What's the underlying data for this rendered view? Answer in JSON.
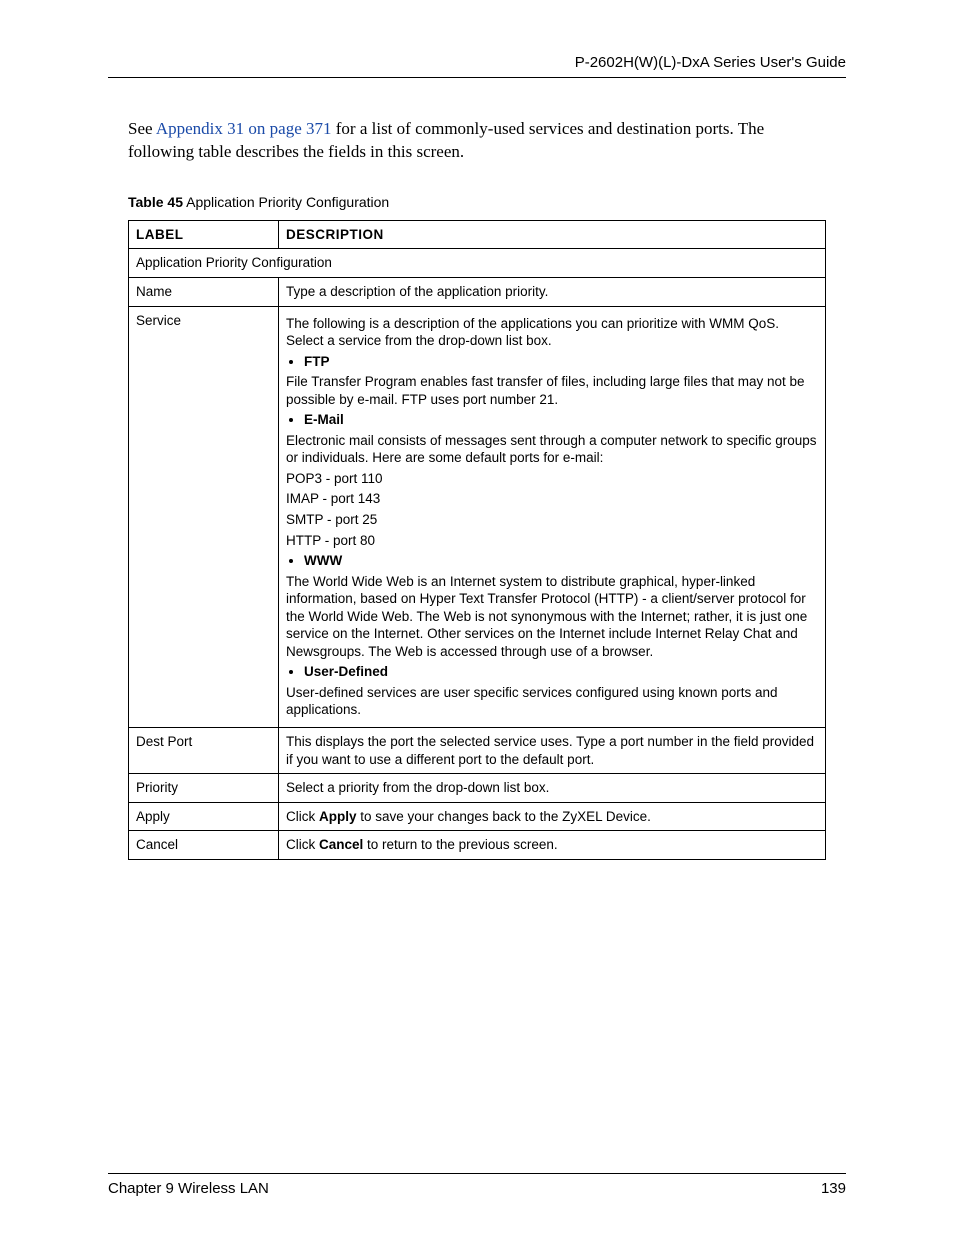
{
  "header": {
    "guide_title": "P-2602H(W)(L)-DxA Series User's Guide"
  },
  "intro": {
    "pre": "See ",
    "link": "Appendix 31 on page 371",
    "post": " for a list of commonly-used services and destination ports. The following table describes the fields in this screen."
  },
  "table_caption": {
    "bold": "Table 45",
    "rest": "   Application Priority Configuration"
  },
  "table": {
    "head_label": "LABEL",
    "head_desc": "DESCRIPTION",
    "section": "Application Priority Configuration",
    "rows": {
      "name": {
        "label": "Name",
        "desc": "Type a description of the application priority."
      },
      "service": {
        "label": "Service",
        "intro": "The following is a description of the applications you can prioritize with WMM QoS. Select a service from the drop-down list box.",
        "ftp_b": "FTP",
        "ftp_d": "File Transfer Program enables fast transfer of files, including large files that may not be possible by e-mail. FTP uses port number 21.",
        "email_b": "E-Mail",
        "email_d": "Electronic mail consists of messages sent through a computer network to specific groups or individuals. Here are some default ports for e-mail:",
        "p_pop3": "POP3 - port 110",
        "p_imap": "IMAP - port 143",
        "p_smtp": "SMTP - port 25",
        "p_http": "HTTP - port 80",
        "www_b": "WWW",
        "www_d": "The World Wide Web is an Internet system to distribute graphical, hyper-linked information, based on Hyper Text Transfer Protocol (HTTP) - a client/server protocol for the World Wide Web. The Web is not synonymous with the Internet; rather, it is just one service on the Internet. Other services on the Internet include Internet Relay Chat and Newsgroups. The Web is accessed through use of a browser.",
        "ud_b": "User-Defined",
        "ud_d": "User-defined services are user specific services configured using known ports and applications."
      },
      "destport": {
        "label": "Dest Port",
        "desc": "This displays the port the selected service uses. Type a port number in the field provided if you want to use a different port to the default port."
      },
      "priority": {
        "label": "Priority",
        "desc": "Select a priority from the drop-down list box."
      },
      "apply": {
        "label": "Apply",
        "pre": "Click ",
        "bold": "Apply",
        "post": " to save your changes back to the ZyXEL Device."
      },
      "cancel": {
        "label": "Cancel",
        "pre": "Click ",
        "bold": "Cancel",
        "post": " to return to the previous screen."
      }
    }
  },
  "footer": {
    "chapter": "Chapter 9 Wireless LAN",
    "page": "139"
  }
}
